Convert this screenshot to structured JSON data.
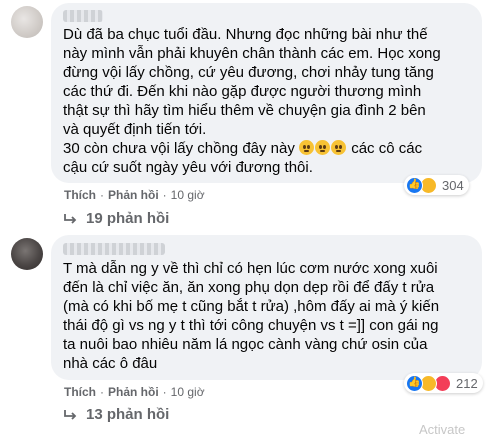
{
  "comment1": {
    "lines": [
      "Dù đã ba chục tuổi đầu. Nhưng đọc những bài như thế",
      "này mình vẫn phải khuyên chân thành các em. Học xong",
      "đừng vội lấy chồng, cứ yêu đương, chơi nhảy tung tăng",
      "các thứ đi. Đến khi nào gặp được người thương mình",
      "thật sự thì hãy tìm hiểu thêm về chuyện gia đình 2 bên",
      "và quyết định tiến tới.",
      "30 còn chưa vội lấy chồng đây này",
      "các cô các",
      "cậu cứ suốt ngày yêu với đương thôi."
    ],
    "reactions_count": "304",
    "like_label": "Thích",
    "reply_label": "Phản hồi",
    "time": "10 giờ",
    "replies_label": "19 phản hồi"
  },
  "comment2": {
    "lines": [
      "T mà dẫn ng y về thì chỉ có hẹn lúc cơm nước xong xuôi",
      "đến là chỉ việc ăn, ăn xong phụ dọn dẹp rồi để đấy t rửa",
      "(mà có khi bố mẹ t cũng bắt t rửa) ,hôm đấy ai mà ý kiến",
      "thái độ gì vs ng y t thì tới công chuyện vs t =]] con gái ng",
      "ta nuôi bao nhiêu năm lá ngọc cành vàng chứ osin của",
      "nhà các ô đâu"
    ],
    "reactions_count": "212",
    "like_label": "Thích",
    "reply_label": "Phản hồi",
    "time": "10 giờ",
    "replies_label": "13 phản hồi"
  },
  "watermark": "Activate",
  "colors": {
    "bubble": "#f0f2f5",
    "text": "#050505",
    "meta": "#65676b",
    "like": "#1877f2",
    "haha": "#f7b928",
    "love": "#f33e58"
  },
  "icons": [
    "avatar",
    "emoji-sad-icon",
    "like-reaction-icon",
    "haha-reaction-icon",
    "love-reaction-icon",
    "reply-arrow-icon"
  ]
}
